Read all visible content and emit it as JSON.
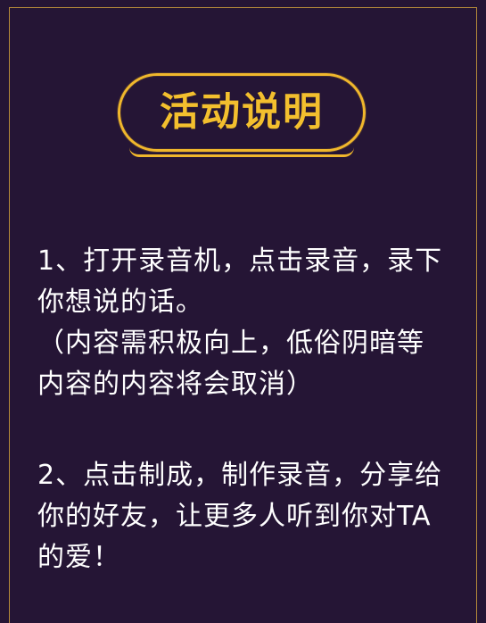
{
  "title": "活动说明",
  "paragraphs": [
    {
      "lines": [
        "1、打开录音机，点击录音，录下",
        "你想说的话。",
        "（内容需积极向上，低俗阴暗等",
        "内容的内容将会取消）"
      ]
    },
    {
      "lines": [
        "2、点击制成，制作录音，分享给",
        "你的好友，让更多人听到你对TA",
        "的爱！"
      ]
    }
  ],
  "colors": {
    "background": "#251535",
    "accent": "#f0b72c",
    "text": "#ffffff",
    "frame": "#b58a3a"
  }
}
